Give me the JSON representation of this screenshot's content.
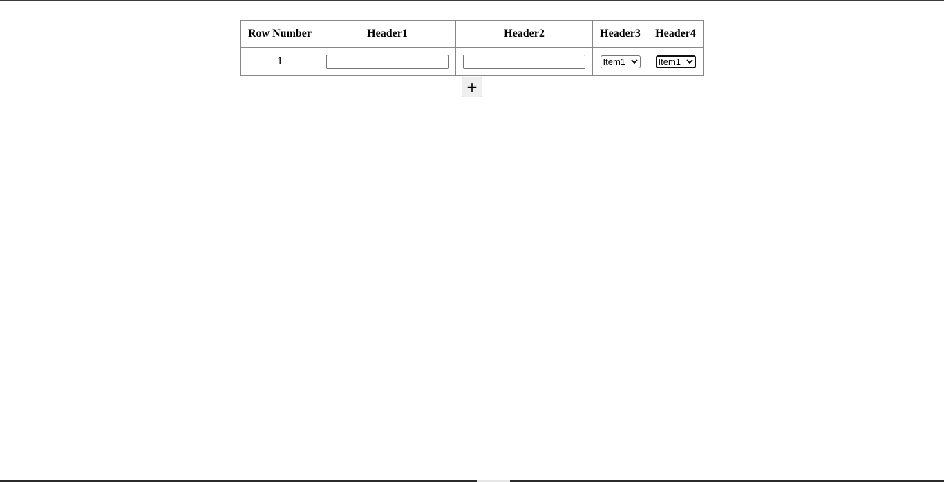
{
  "table": {
    "headers": [
      "Row Number",
      "Header1",
      "Header2",
      "Header3",
      "Header4"
    ],
    "rows": [
      {
        "row_number": "1",
        "header1_value": "",
        "header2_value": "",
        "header3_selected": "Item1",
        "header4_selected": "Item1"
      }
    ]
  },
  "add_button": {
    "label": "+"
  },
  "colors": {
    "border": "#888888",
    "button_bg": "#efefef"
  },
  "icons": {
    "select_arrow": "chevron-down-icon"
  }
}
